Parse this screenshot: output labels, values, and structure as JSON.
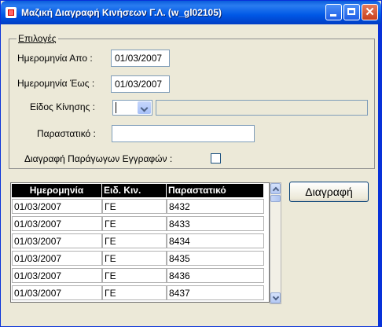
{
  "window": {
    "title": "Μαζική Διαγραφή Κινήσεων Γ.Λ.   (w_gl02105)",
    "controls": {
      "minimize": "minimize-icon",
      "maximize": "maximize-icon",
      "close": "close-icon",
      "close_glyph": "✕"
    }
  },
  "options": {
    "group_label": "Επιλογές",
    "date_from_label": "Ημερομηνία Απο  :",
    "date_from_value": "01/03/2007",
    "date_to_label": "Ημερομηνία Έως :",
    "date_to_value": "01/03/2007",
    "movement_type_label": "Είδος Κίνησης :",
    "movement_type_value": "",
    "movement_type_description": "",
    "document_label": "Παραστατικό :",
    "document_value": "",
    "delete_derived_label": "Διαγραφή Παράγωγων Εγγραφών :",
    "delete_derived_checked": false
  },
  "grid": {
    "columns": [
      "Ημερομηνία",
      "Ειδ. Κιν.",
      "Παραστατικό"
    ],
    "rows": [
      [
        "01/03/2007",
        "ΓΕ",
        "8432"
      ],
      [
        "01/03/2007",
        "ΓΕ",
        "8433"
      ],
      [
        "01/03/2007",
        "ΓΕ",
        "8434"
      ],
      [
        "01/03/2007",
        "ΓΕ",
        "8435"
      ],
      [
        "01/03/2007",
        "ΓΕ",
        "8436"
      ],
      [
        "01/03/2007",
        "ΓΕ",
        "8437"
      ]
    ]
  },
  "actions": {
    "delete_label": "Διαγραφή"
  },
  "colors": {
    "titlebar": "#0058e6",
    "face": "#ece9d8",
    "header_bg": "#000000"
  }
}
